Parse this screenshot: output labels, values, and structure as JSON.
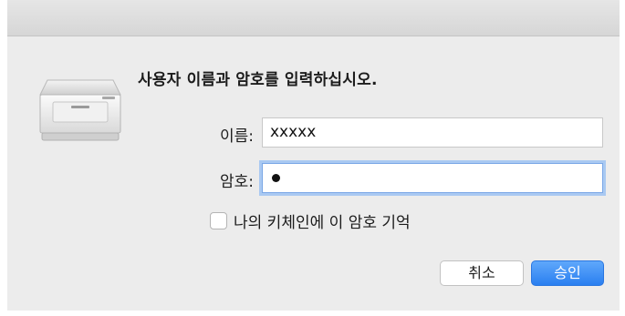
{
  "dialog": {
    "prompt": "사용자 이름과 암호를 입력하십시오.",
    "name_label": "이름:",
    "name_value": "xxxxx",
    "password_label": "암호:",
    "password_masked_length": 1,
    "remember_label": "나의 키체인에 이 암호 기억",
    "remember_checked": false,
    "cancel_label": "취소",
    "ok_label": "승인"
  },
  "colors": {
    "accent": "#2a7ff0",
    "focus_ring": "#a9c9f2",
    "background": "#ececec"
  },
  "icons": {
    "app_icon": "printer-icon"
  }
}
